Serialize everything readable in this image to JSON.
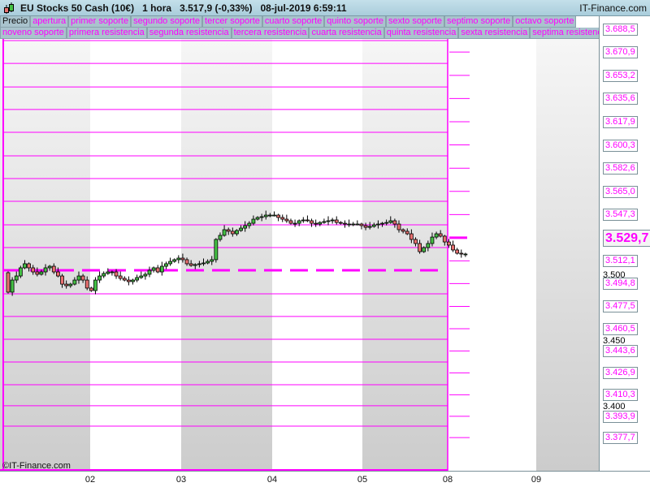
{
  "header": {
    "title": "EU Stocks 50 Cash (10€)   1 hora   3.517,9 (-0,33%)   08-jul-2019 6:59:11",
    "brand": "IT-Finance.com"
  },
  "legend": {
    "row1": [
      "Precio",
      "apertura",
      "primer soporte",
      "segundo soporte",
      "tercer soporte",
      "cuarto soporte",
      "quinto soporte",
      "sexto soporte",
      "septimo soporte",
      "octavo soporte"
    ],
    "row2": [
      "noveno soporte",
      "primera resistencia",
      "segunda resistencia",
      "tercera resistencia",
      "cuarta resistencia",
      "quinta resistencia",
      "sexta resistencia",
      "septima resistencia"
    ]
  },
  "copyright": "©IT-Finance.com",
  "colors": {
    "level": "#ff00ff",
    "up": "#44c044",
    "down": "#e87070",
    "band": "#d0d0d0"
  },
  "chart_data": {
    "type": "candlestick",
    "symbol": "EU Stocks 50 Cash (10€)",
    "interval": "1 hora",
    "x_tick_labels": [
      "02",
      "03",
      "04",
      "05",
      "08",
      "09"
    ],
    "y_tick_labels": [
      "3.500",
      "3.450",
      "3.400"
    ],
    "y_ticks": [
      3500,
      3450,
      3400
    ],
    "current_price": "3.529,7",
    "current_price_value": 3529.7,
    "level_labels": [
      "3.688,5",
      "3.670,9",
      "3.653,2",
      "3.635,6",
      "3.617,9",
      "3.600,3",
      "3.582,6",
      "3.565,0",
      "3.547,3",
      "3.512,1",
      "3.494,8",
      "3.477,5",
      "3.460,5",
      "3.443,6",
      "3.426,9",
      "3.410,3",
      "3.393,9",
      "3.377,7"
    ],
    "level_values": [
      3688.5,
      3670.9,
      3653.2,
      3635.6,
      3617.9,
      3600.3,
      3582.6,
      3565.0,
      3547.3,
      3512.1,
      3494.8,
      3477.5,
      3460.5,
      3443.6,
      3426.9,
      3410.3,
      3393.9,
      3377.7
    ],
    "prior_levels": [
      3679.6,
      3662.3,
      3644.4,
      3627.2,
      3609.9,
      3592.0,
      3574.7,
      3557.4,
      3539.5,
      3522.2,
      3487.0,
      3469.8,
      3452.5,
      3435.2,
      3417.9,
      3401.9,
      3386.4
    ],
    "prior_open": 3504.9,
    "first_open": 3503.1,
    "closes": [
      3488.3,
      3497.5,
      3500.6,
      3506.8,
      3509.9,
      3506.8,
      3503.7,
      3501.9,
      3503.7,
      3506.8,
      3508.0,
      3503.7,
      3500.6,
      3494.4,
      3493.2,
      3494.4,
      3497.5,
      3500.6,
      3497.5,
      3491.4,
      3489.5,
      3497.5,
      3500.6,
      3502.5,
      3503.7,
      3503.7,
      3500.6,
      3498.8,
      3497.5,
      3496.3,
      3497.5,
      3499.4,
      3500.6,
      3501.9,
      3504.9,
      3506.8,
      3503.7,
      3508.0,
      3509.9,
      3511.7,
      3513.0,
      3514.2,
      3513.0,
      3509.9,
      3508.6,
      3509.3,
      3509.9,
      3510.5,
      3511.7,
      3513.0,
      3528.4,
      3531.5,
      3535.8,
      3534.6,
      3532.7,
      3535.2,
      3537.0,
      3538.9,
      3540.7,
      3543.8,
      3545.1,
      3545.7,
      3546.9,
      3546.9,
      3546.9,
      3545.1,
      3543.8,
      3542.6,
      3540.7,
      3540.7,
      3542.6,
      3543.2,
      3542.6,
      3540.7,
      3540.1,
      3541.3,
      3542.0,
      3542.6,
      3543.2,
      3541.3,
      3540.7,
      3540.1,
      3540.1,
      3540.1,
      3540.1,
      3538.9,
      3537.6,
      3538.3,
      3539.5,
      3540.1,
      3540.7,
      3541.3,
      3542.6,
      3540.1,
      3535.8,
      3534.6,
      3532.7,
      3528.4,
      3525.3,
      3519.1,
      3522.2,
      3525.3,
      3530.2,
      3532.7,
      3530.9,
      3526.5,
      3524.1,
      3520.4,
      3517.9,
      3517.3,
      3517.3
    ]
  }
}
